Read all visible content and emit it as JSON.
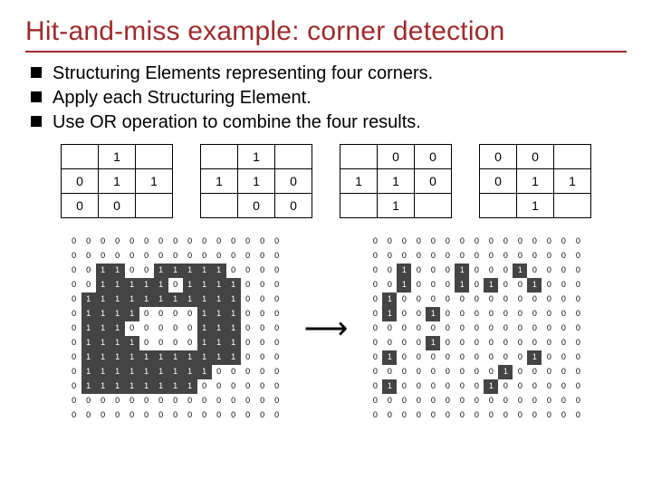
{
  "title": "Hit-and-miss example: corner detection",
  "bullets": [
    "Structuring Elements representing four corners.",
    "Apply each Structuring Element.",
    "Use OR operation to combine the four results."
  ],
  "arrow": "⟶",
  "structuring_elements": [
    [
      [
        "",
        "1",
        ""
      ],
      [
        "0",
        "1",
        "1"
      ],
      [
        "0",
        "0",
        ""
      ]
    ],
    [
      [
        "",
        "1",
        ""
      ],
      [
        "1",
        "1",
        "0"
      ],
      [
        "",
        "0",
        "0"
      ]
    ],
    [
      [
        "",
        "0",
        "0"
      ],
      [
        "1",
        "1",
        "0"
      ],
      [
        "",
        "1",
        ""
      ]
    ],
    [
      [
        "0",
        "0",
        ""
      ],
      [
        "0",
        "1",
        "1"
      ],
      [
        "",
        "1",
        ""
      ]
    ]
  ],
  "input_grid": [
    "000000000000000",
    "000000000000000",
    "001100111110000",
    "001111101111000",
    "011111111111000",
    "011110000111000",
    "011100000111000",
    "011110000111000",
    "011111111111000",
    "011111111100000",
    "011111111000000",
    "000000000000000",
    "000000000000000"
  ],
  "output_grid": [
    "000000000000000",
    "000000000000000",
    "001000100010000",
    "001000101001000",
    "010000000000000",
    "010010000000000",
    "000000000000000",
    "000010000000000",
    "010000000001000",
    "000000000100000",
    "010000001000000",
    "000000000000000",
    "000000000000000"
  ]
}
